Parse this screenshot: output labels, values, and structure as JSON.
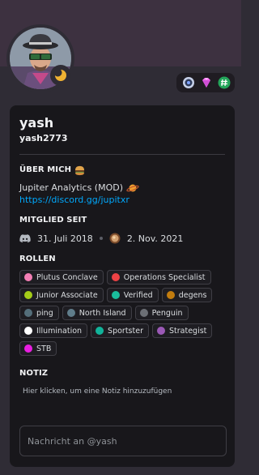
{
  "profile": {
    "display_name": "yash",
    "username": "yash2773",
    "status": "idle",
    "badges": [
      "hypesquad-balance-icon",
      "nitro-gem-icon",
      "hashtag-badge-icon"
    ]
  },
  "about": {
    "title": "ÜBER MICH",
    "title_emoji": "burger-emoji-icon",
    "line": "Jupiter Analytics (MOD)",
    "line_emoji": "ringed-planet-emoji-icon",
    "link": "https://discord.gg/jupitxr"
  },
  "member_since": {
    "title": "MITGLIED SEIT",
    "discord_date": "31. Juli 2018",
    "server_date": "2. Nov. 2021"
  },
  "roles": {
    "title": "ROLLEN",
    "items": [
      {
        "name": "Plutus Conclave",
        "color": "#f47fb5"
      },
      {
        "name": "Operations Specialist",
        "color": "#ed4245"
      },
      {
        "name": "Junior Associate",
        "color": "#a4cc18"
      },
      {
        "name": "Verified",
        "color": "#1abc9c"
      },
      {
        "name": "degens",
        "color": "#c27c0e"
      },
      {
        "name": "ping",
        "color": "#546e7a"
      },
      {
        "name": "North Island",
        "color": "#607d8b"
      },
      {
        "name": "Penguin",
        "color": "#6c6f75"
      },
      {
        "name": "Illumination",
        "color": "#ffffff"
      },
      {
        "name": "Sportster",
        "color": "#11b39a"
      },
      {
        "name": "Strategist",
        "color": "#9b59b6"
      },
      {
        "name": "STB",
        "color": "#e91ee0"
      }
    ]
  },
  "note": {
    "title": "NOTIZ",
    "placeholder": "Hier klicken, um eine Notiz hinzuzufügen"
  },
  "message": {
    "placeholder": "Nachricht an @yash"
  }
}
